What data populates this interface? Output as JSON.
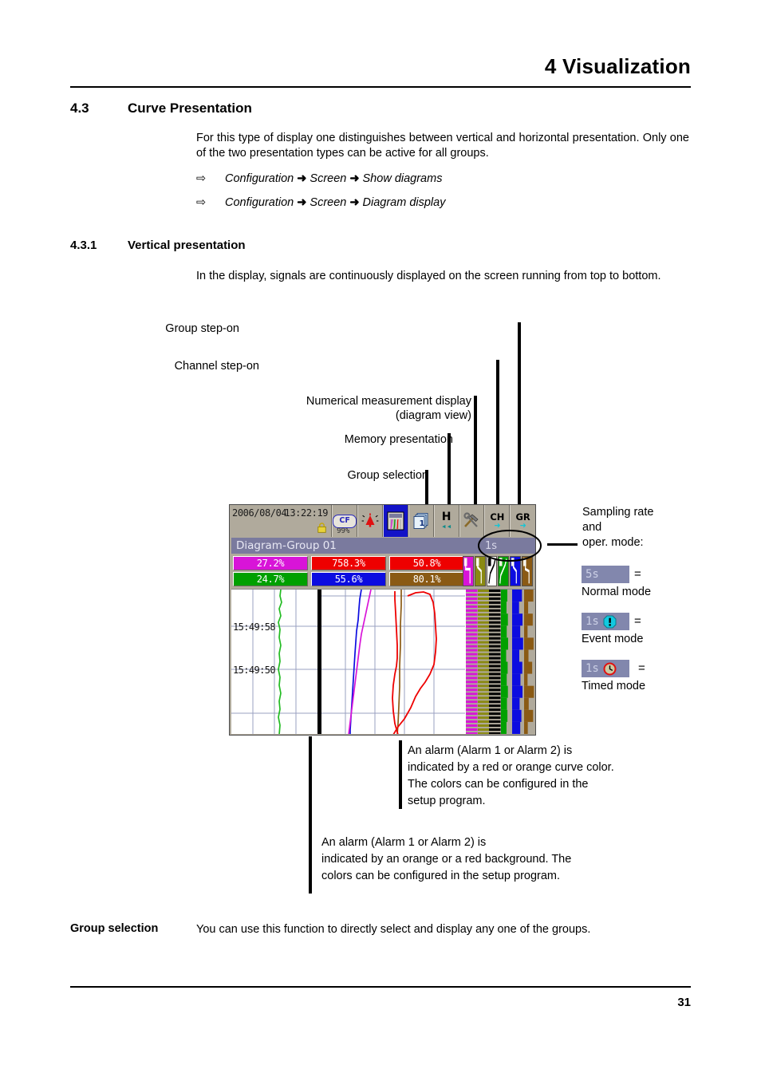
{
  "header": {
    "chapter_title": "4 Visualization"
  },
  "sections": {
    "s43_number": "4.3",
    "s43_title": "Curve Presentation",
    "s43_intro": "For this type of display one distinguishes between vertical and horizontal presentation. Only one of the two presentation types can be active for all groups.",
    "s431_number": "4.3.1",
    "s431_title": "Vertical presentation",
    "s431_intro": "In the display, signals are continuously displayed on the screen running from top to bottom."
  },
  "bullets": [
    {
      "arrow": "⇨",
      "part1": "Configuration",
      "chev": "➜",
      "part2": "Screen",
      "part3": "Show diagrams"
    },
    {
      "arrow": "⇨",
      "part1": "Configuration",
      "chev": "➜",
      "part2": "Screen",
      "part3": "Diagram display"
    }
  ],
  "callouts": [
    {
      "label": "Group step-on"
    },
    {
      "label": "Channel step-on"
    },
    {
      "label": "Numerical measurement display\n(diagram view)"
    },
    {
      "label": "Memory presentation"
    },
    {
      "label": "Group selection"
    }
  ],
  "device": {
    "date": "2006/08/04",
    "time": "13:22:19",
    "lock_icon": "padlock-icon",
    "cf_label": "CF",
    "cf_percent": "99%",
    "toolbar_icons": [
      "cf-memory-icon",
      "alarm-bell-icon",
      "diagram-view-icon",
      "group-pages-icon",
      "history-rewind-icon",
      "tools-config-icon",
      "channel-step-on-icon",
      "group-step-on-icon"
    ],
    "toolbar_labels": {
      "history_main": "H",
      "history_sub": "◂◂",
      "channel_main": "CH",
      "channel_arrow": "➜",
      "group_main": "GR",
      "group_arrow": "➜",
      "page_number": "1"
    },
    "group_name": "Diagram-Group 01",
    "sample_rate": "1s",
    "values": [
      {
        "value": "27.2%",
        "color": "#d814d8",
        "text_color": "#ffffff"
      },
      {
        "value": "758.3%",
        "color": "#ee0000",
        "text_color": "#ffffff"
      },
      {
        "value": "50.8%",
        "color": "#ee0000",
        "text_color": "#ffffff"
      },
      {
        "value": "24.7%",
        "color": "#00a000",
        "text_color": "#ffffff"
      },
      {
        "value": "55.6%",
        "color": "#0c0ce0",
        "text_color": "#ffffff"
      },
      {
        "value": "80.1%",
        "color": "#8a5a14",
        "text_color": "#ffffff"
      }
    ],
    "channel_colors": [
      "#d814d8",
      "#8a8a12",
      "#000000",
      "#00a000",
      "#0c0ce0",
      "#8a5a14"
    ],
    "time_labels": [
      "15:49:58",
      "15:49:50"
    ],
    "curve_colors": {
      "green": "#22bb22",
      "blue": "#0c0ce0",
      "magenta": "#d814d8",
      "red": "#ee0000",
      "brown": "#8a5a14"
    }
  },
  "legend": {
    "sampling_heading": "Sampling rate\nand\noper. mode:",
    "modes": [
      {
        "chip": "5s",
        "icon": "none",
        "eq": "=",
        "label": "Normal mode"
      },
      {
        "chip": "1s",
        "icon": "exclamation-icon",
        "eq": "=",
        "label": "Event mode"
      },
      {
        "chip": "1s",
        "icon": "clock-icon",
        "eq": "=",
        "label": "Timed mode"
      }
    ]
  },
  "notes": {
    "curve_alarm": "An alarm (Alarm 1 or Alarm 2) is\nindicated by a red or orange curve color.\nThe colors can be configured in the\nsetup program.",
    "background_alarm": "An alarm (Alarm 1 or Alarm 2) is\nindicated by an orange or a red background. The\ncolors can be configured in the setup program."
  },
  "footer": {
    "group_selection_label": "Group selection",
    "group_selection_text": "You can use this function to directly select and display any one of the groups.",
    "page_number": "31"
  }
}
